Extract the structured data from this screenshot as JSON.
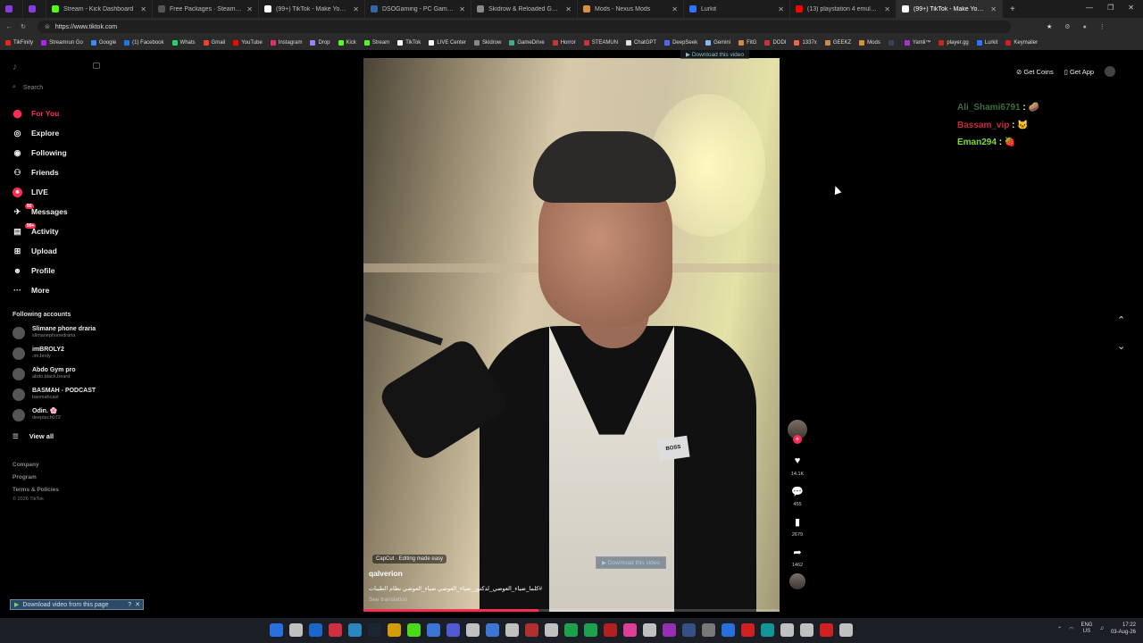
{
  "browser": {
    "tabs": [
      {
        "title": "",
        "color": "#8a3bdb"
      },
      {
        "title": "",
        "color": "#8a3bdb"
      },
      {
        "title": "Stream - Kick Dashboard",
        "color": "#53fc18"
      },
      {
        "title": "Free Packages · SteamDB",
        "color": "#555555"
      },
      {
        "title": "(99+) TikTok - Make Your Day",
        "color": "#ffffff"
      },
      {
        "title": "DSOGaming - PC Games News, S",
        "color": "#3366aa"
      },
      {
        "title": "Skidrow & Reloaded Games - Do",
        "color": "#888888"
      },
      {
        "title": "Mods - Nexus Mods",
        "color": "#d98f40"
      },
      {
        "title": "Lurkit",
        "color": "#2f74ff"
      },
      {
        "title": "(13) playstation 4 emulator on pc",
        "color": "#ff0000"
      },
      {
        "title": "(99+) TikTok - Make Your Day",
        "color": "#ffffff"
      }
    ],
    "url": "https://www.tiktok.com",
    "bookmarks": [
      {
        "label": "TikFinity",
        "color": "#e22"
      },
      {
        "label": "Streamrun Go",
        "color": "#a2f"
      },
      {
        "label": "Google",
        "color": "#4285f4"
      },
      {
        "label": "(1) Facebook",
        "color": "#1877f2"
      },
      {
        "label": "Whats",
        "color": "#25d366"
      },
      {
        "label": "Gmail",
        "color": "#ea4335"
      },
      {
        "label": "YouTube",
        "color": "#ff0000"
      },
      {
        "label": "Instagram",
        "color": "#e1306c"
      },
      {
        "label": "Drop",
        "color": "#a7f"
      },
      {
        "label": "Kick",
        "color": "#53fc18"
      },
      {
        "label": "Stream",
        "color": "#53fc18"
      },
      {
        "label": "TikTok",
        "color": "#fff"
      },
      {
        "label": "LIVE Center",
        "color": "#fff"
      },
      {
        "label": "Skidrow",
        "color": "#888"
      },
      {
        "label": "GameDrive",
        "color": "#4a8"
      },
      {
        "label": "Horror",
        "color": "#c33"
      },
      {
        "label": "STEAMUN",
        "color": "#c33"
      },
      {
        "label": "ChatGPT",
        "color": "#ddd"
      },
      {
        "label": "DeepSeek",
        "color": "#4d6bfe"
      },
      {
        "label": "Gemini",
        "color": "#8ab4f8"
      },
      {
        "label": "FitG",
        "color": "#c84"
      },
      {
        "label": "DODI",
        "color": "#c33"
      },
      {
        "label": "1337x",
        "color": "#e64"
      },
      {
        "label": "GEEKZ",
        "color": "#c84"
      },
      {
        "label": "Mods",
        "color": "#d98f40"
      },
      {
        "label": "",
        "color": "#345"
      },
      {
        "label": "Yamli™",
        "color": "#a3c"
      },
      {
        "label": "player.gg",
        "color": "#c22"
      },
      {
        "label": "Lurkit",
        "color": "#2f74ff"
      },
      {
        "label": "Keymailer",
        "color": "#c22"
      }
    ]
  },
  "sidebar": {
    "search_placeholder": "Search",
    "items": [
      {
        "label": "For You",
        "icon": "home-icon",
        "glyph": "⬤"
      },
      {
        "label": "Explore",
        "icon": "compass-icon",
        "glyph": "◎"
      },
      {
        "label": "Following",
        "icon": "following-icon",
        "glyph": "◉"
      },
      {
        "label": "Friends",
        "icon": "friends-icon",
        "glyph": "⚇"
      },
      {
        "label": "LIVE",
        "icon": "live-icon",
        "glyph": "◉"
      },
      {
        "label": "Messages",
        "icon": "messages-icon",
        "glyph": "✈"
      },
      {
        "label": "Activity",
        "icon": "activity-icon",
        "glyph": "▤"
      },
      {
        "label": "Upload",
        "icon": "upload-icon",
        "glyph": "⊞"
      },
      {
        "label": "Profile",
        "icon": "profile-icon",
        "glyph": "☻"
      },
      {
        "label": "More",
        "icon": "more-icon",
        "glyph": "···"
      }
    ],
    "messages_badge": "92",
    "activity_badge": "99+",
    "following_title": "Following accounts",
    "accounts": [
      {
        "name": "Slimane phone draria",
        "handle": "slimanephonedraria"
      },
      {
        "name": "imBROLY2",
        "handle": ".im.broly"
      },
      {
        "name": "Abdo Gym pro",
        "handle": "abdo.black.beard"
      },
      {
        "name": "BASMAH - PODCAST",
        "handle": "basmahcast"
      },
      {
        "name": "Odin. 🌸",
        "handle": "deeptech072"
      }
    ],
    "view_all": "View all",
    "footer": [
      "Company",
      "Program",
      "Terms & Policies"
    ],
    "copyright": "© 2026 TikTok"
  },
  "video": {
    "capcut": "CapCut · Editing made easy",
    "creator": "qalverion",
    "caption": "#كلما_ضياء_العوضي_لدكتور_ضياء_العوضي   ضياء_العوضي نظام الطيبات",
    "see_translation": "See translation",
    "download_inline": "Download this video",
    "download_top": "Download this video",
    "patch_text": "BOSS",
    "progress": 0.42
  },
  "actions": {
    "likes": "14.1K",
    "comments": "455",
    "saves": "2679",
    "shares": "1462"
  },
  "topright": {
    "get_coins": "Get Coins",
    "get_app": "Get App"
  },
  "chat": [
    {
      "user": "Ali_Shami6791",
      "suffix": " : 🥔",
      "color": "#3c6e3c"
    },
    {
      "user": "Bassam_vip",
      "suffix": " : 🐱",
      "color": "#c8283c"
    },
    {
      "user": "Eman294",
      "suffix": " : 🍓",
      "color": "#7ddc3c"
    }
  ],
  "download_bar": "Download video from this page",
  "taskbar": {
    "lang_top": "ENG",
    "lang_bottom": "US",
    "time": "17:22",
    "date": "03-Aug-26",
    "icons": [
      "#2a7fff",
      "#ddd",
      "#1a73e8",
      "#e34",
      "#2c9ad8",
      "#1b2838",
      "#f4b400",
      "#53fc18",
      "#4285f4",
      "#5865f2",
      "#ddd",
      "#4285f4",
      "#ddd",
      "#c33",
      "#ddd",
      "#1db954",
      "#1db954",
      "#c22",
      "#f4a",
      "#ddd",
      "#a3c",
      "#3b5998",
      "#888",
      "#2a7fff",
      "#e22",
      "#1aa",
      "#ddd",
      "#ddd",
      "#e22",
      "#ddd"
    ]
  }
}
